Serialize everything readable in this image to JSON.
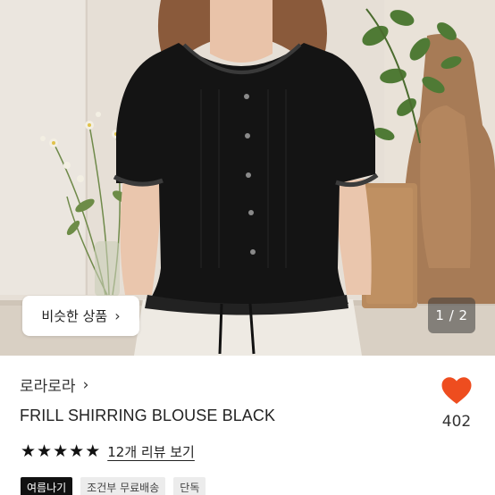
{
  "photo": {
    "similar_button_label": "비슷한 상품",
    "page_counter": "1 / 2"
  },
  "product": {
    "shop_name": "로라로라",
    "title": "FRILL SHIRRING BLOUSE BLACK",
    "like_count": "402",
    "rating_stars": 5,
    "reviews_link": "12개 리뷰 보기",
    "tags": [
      {
        "label": "여름나기",
        "style": "dark"
      },
      {
        "label": "조건부 무료배송",
        "style": "light"
      },
      {
        "label": "단독",
        "style": "light"
      }
    ]
  },
  "colors": {
    "heart": "#ee4d1f",
    "tag_dark_bg": "#111111",
    "tag_light_bg": "#ececec"
  },
  "icons": {
    "like": "heart-icon",
    "chevron": "chevron-right-icon",
    "star": "star-icon"
  }
}
